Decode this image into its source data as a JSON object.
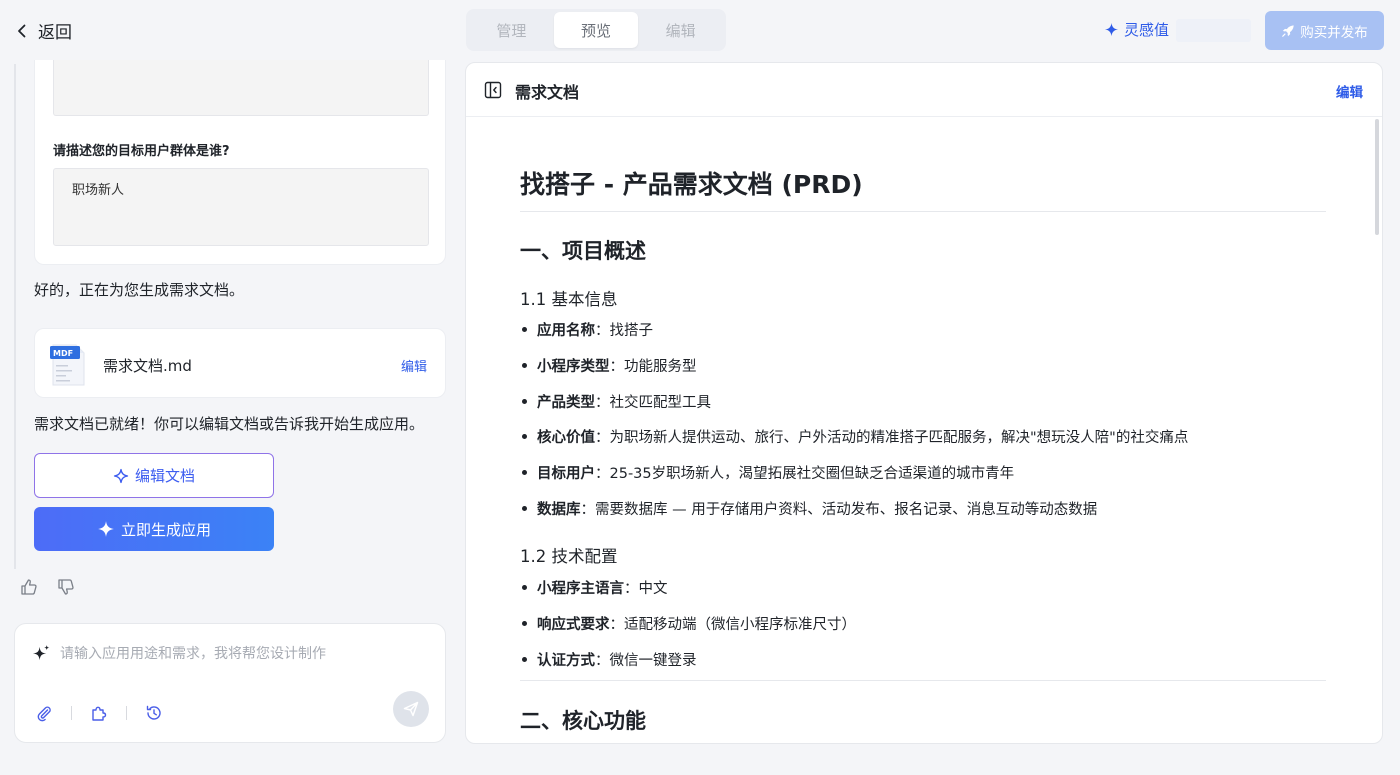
{
  "topbar": {
    "back_label": "返回",
    "tabs": [
      {
        "label": "管理",
        "active": false
      },
      {
        "label": "预览",
        "active": true
      },
      {
        "label": "编辑",
        "active": false
      }
    ],
    "inspiration_label": "灵感值",
    "buy_publish_label": "购买并发布"
  },
  "chat": {
    "question_label": "请描述您的目标用户群体是谁?",
    "answer_value": "职场新人",
    "generating_message": "好的，正在为您生成需求文档。",
    "file": {
      "badge": "MDF",
      "name": "需求文档.md",
      "edit_label": "编辑"
    },
    "ready_message": "需求文档已就绪！你可以编辑文档或告诉我开始生成应用。",
    "edit_doc_button": "编辑文档",
    "generate_button": "立即生成应用",
    "input_placeholder": "请输入应用用途和需求，我将帮您设计制作"
  },
  "doc": {
    "header_title": "需求文档",
    "header_edit_label": "编辑",
    "title": "找搭子 - 产品需求文档 (PRD)",
    "section1": "一、项目概述",
    "sub1": "1.1 基本信息",
    "basic_info": [
      {
        "key": "应用名称",
        "value": "：找搭子"
      },
      {
        "key": "小程序类型",
        "value": "：功能服务型"
      },
      {
        "key": "产品类型",
        "value": "：社交匹配型工具"
      },
      {
        "key": "核心价值",
        "value": "：为职场新人提供运动、旅行、户外活动的精准搭子匹配服务，解决\"想玩没人陪\"的社交痛点"
      },
      {
        "key": "目标用户",
        "value": "：25-35岁职场新人，渴望拓展社交圈但缺乏合适渠道的城市青年"
      },
      {
        "key": "数据库",
        "value": "：需要数据库 — 用于存储用户资料、活动发布、报名记录、消息互动等动态数据"
      }
    ],
    "sub2": "1.2 技术配置",
    "tech_config": [
      {
        "key": "小程序主语言",
        "value": "：中文"
      },
      {
        "key": "响应式要求",
        "value": "：适配移动端（微信小程序标准尺寸）"
      },
      {
        "key": "认证方式",
        "value": "：微信一键登录"
      }
    ],
    "section2": "二、核心功能"
  },
  "colors": {
    "accent": "#2f5ce8",
    "buy_button": "#a8c1f3",
    "generate_gradient_start": "#4d6cf7",
    "generate_gradient_end": "#3b82f6"
  }
}
